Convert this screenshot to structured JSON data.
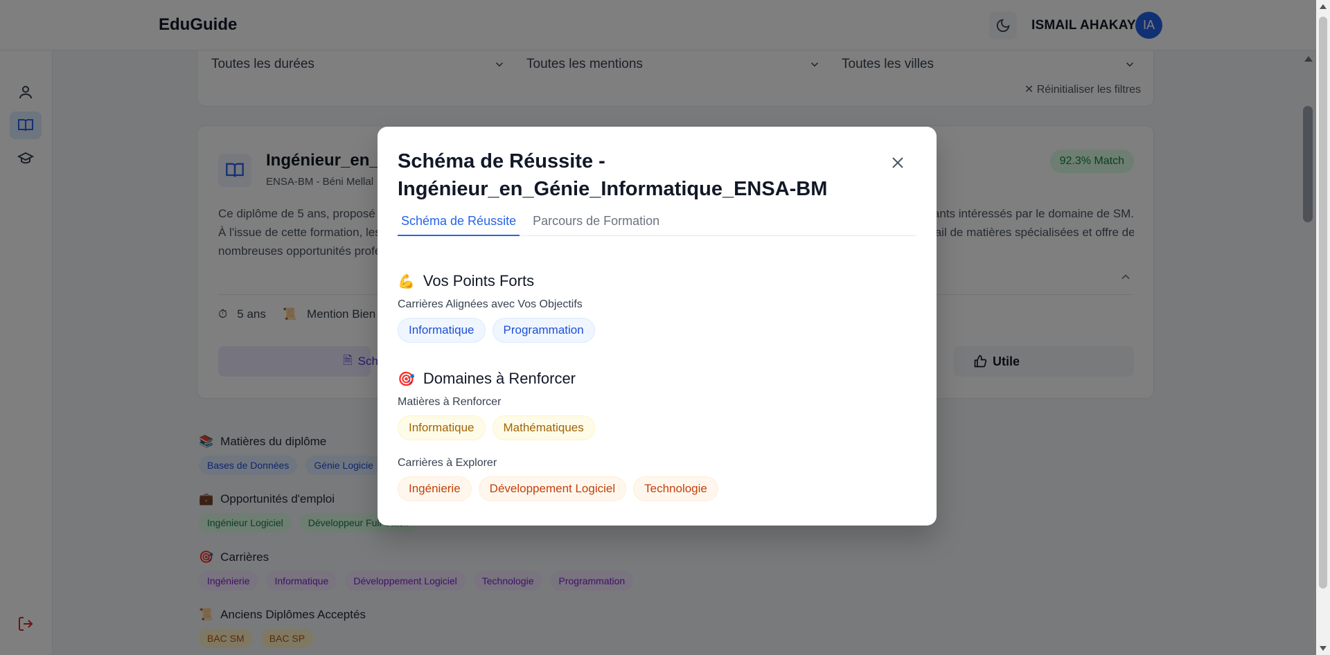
{
  "header": {
    "logo": "EduGuide",
    "user_name": "ISMAIL AHAKAY",
    "avatar_initials": "IA"
  },
  "filters": {
    "duration": "Toutes les durées",
    "mention": "Toutes les mentions",
    "city": "Toutes les villes",
    "reset_label": "Réinitialiser les filtres"
  },
  "program": {
    "title": "Ingénieur_en_G",
    "subtitle": "ENSA-BM - Béni Mellal",
    "match": "92.3% Match",
    "desc_left": [
      "Ce diplôme de 5 ans, proposé p",
      "À l'issue de cette formation, les",
      "nombreuses opportunités profe"
    ],
    "desc_right": [
      "ants intéressés par le domaine de SM.",
      "tail de matières spécialisées et offre de"
    ],
    "duration": "5 ans",
    "mention": "Mention Bien",
    "action_left": "Sche",
    "action_right": "Utile"
  },
  "sections": {
    "matieres": {
      "title": "Matières du diplôme",
      "chips": [
        "Bases de Données",
        "Génie Logicie"
      ]
    },
    "emploi": {
      "title": "Opportunités d'emploi",
      "chips": [
        "Ingénieur Logiciel",
        "Développeur Full Stack"
      ]
    },
    "carrieres": {
      "title": "Carrières",
      "chips": [
        "Ingénierie",
        "Informatique",
        "Développement Logiciel",
        "Technologie",
        "Programmation"
      ]
    },
    "anciens": {
      "title": "Anciens Diplômes Acceptés",
      "chips": [
        "BAC SM",
        "BAC SP"
      ]
    }
  },
  "modal": {
    "title": "Schéma de Réussite - Ingénieur_en_Génie_Informatique_ENSA-BM",
    "tabs": [
      "Schéma de Réussite",
      "Parcours de Formation"
    ],
    "strengths": {
      "heading": "Vos Points Forts",
      "emoji": "💪",
      "sub": "Carrières Alignées avec Vos Objectifs",
      "chips": [
        "Informatique",
        "Programmation"
      ]
    },
    "reinforce": {
      "heading": "Domaines à Renforcer",
      "emoji": "🎯",
      "sub1": "Matières à Renforcer",
      "chips1": [
        "Informatique",
        "Mathématiques"
      ],
      "sub2": "Carrières à Explorer",
      "chips2": [
        "Ingénierie",
        "Développement Logiciel",
        "Technologie"
      ]
    }
  },
  "colors": {
    "accent": "#2563eb",
    "match_bg": "#dcfce7",
    "match_text": "#15803d"
  }
}
